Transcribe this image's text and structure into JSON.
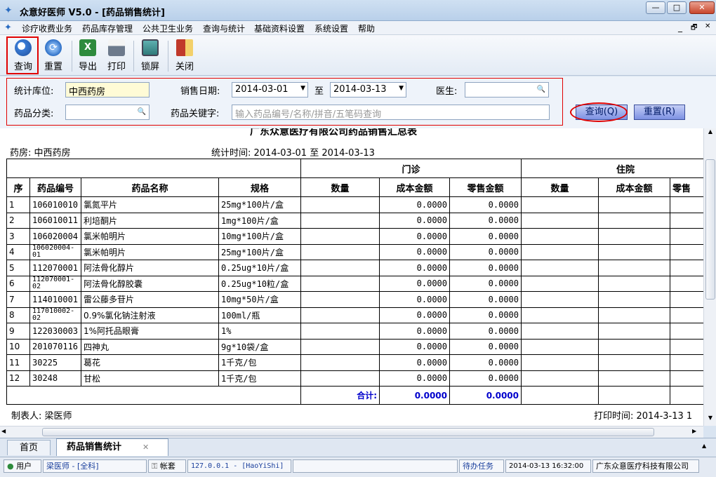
{
  "window": {
    "title": "众意好医师 V5.0 - [药品销售统计]",
    "minimize": "—",
    "maximize": "□",
    "close": "✕"
  },
  "menu": [
    "诊疗收费业务",
    "药品库存管理",
    "公共卫生业务",
    "查询与统计",
    "基础资料设置",
    "系统设置",
    "帮助"
  ],
  "mdi_controls": [
    "_",
    "🗗",
    "✕"
  ],
  "toolbar": [
    {
      "label": "查询",
      "icon": "magnifier-icon",
      "color": "#3a7bd5"
    },
    {
      "label": "重置",
      "icon": "refresh-icon",
      "color": "#2d6fc6"
    },
    {
      "label": "导出",
      "icon": "excel-export-icon",
      "color": "#2e8b3d"
    },
    {
      "label": "打印",
      "icon": "printer-icon",
      "color": "#6d7a8c"
    },
    {
      "label": "锁屏",
      "icon": "monitor-lock-icon",
      "color": "#3a8a8a"
    },
    {
      "label": "关闭",
      "icon": "exit-door-icon",
      "color": "#c0392b"
    }
  ],
  "filters": {
    "warehouse_label": "统计库位:",
    "warehouse_value": "中西药房",
    "date_label": "销售日期:",
    "date_from": "2014-03-01",
    "date_to_label": "至",
    "date_to": "2014-03-13",
    "doctor_label": "医生:",
    "doctor_value": "",
    "category_label": "药品分类:",
    "category_value": "",
    "keyword_label": "药品关键字:",
    "keyword_placeholder": "输入药品编号/名称/拼音/五笔码查询",
    "query_btn": "查询(Q)",
    "reset_btn": "重置(R)"
  },
  "report": {
    "title": "广东众意医疗有限公司药品销售汇总表",
    "pharmacy": "药房: 中西药房",
    "period": "统计时间: 2014-03-01 至 2014-03-13",
    "group_outpatient": "门诊",
    "group_inpatient": "住院",
    "columns": [
      "序",
      "药品编号",
      "药品名称",
      "规格",
      "数量",
      "成本金额",
      "零售金额",
      "数量",
      "成本金额",
      "零售"
    ],
    "rows": [
      [
        "1",
        "106010010",
        "氯氮平片",
        "25mg*100片/盒",
        "",
        "0.0000",
        "0.0000"
      ],
      [
        "2",
        "106010011",
        "利培酮片",
        "1mg*100片/盒",
        "",
        "0.0000",
        "0.0000"
      ],
      [
        "3",
        "106020004",
        "氯米帕明片",
        "10mg*100片/盒",
        "",
        "0.0000",
        "0.0000"
      ],
      [
        "4",
        "106020004-01",
        "氯米帕明片",
        "25mg*100片/盒",
        "",
        "0.0000",
        "0.0000"
      ],
      [
        "5",
        "112070001",
        "阿法骨化醇片",
        "0.25ug*10片/盒",
        "",
        "0.0000",
        "0.0000"
      ],
      [
        "6",
        "112070001-02",
        "阿法骨化醇胶囊",
        "0.25ug*10粒/盒",
        "",
        "0.0000",
        "0.0000"
      ],
      [
        "7",
        "114010001",
        "雷公藤多苷片",
        "10mg*50片/盒",
        "",
        "0.0000",
        "0.0000"
      ],
      [
        "8",
        "117010002-02",
        "0.9%氯化钠注射液",
        "100ml/瓶",
        "",
        "0.0000",
        "0.0000"
      ],
      [
        "9",
        "122030003",
        "1%阿托品眼膏",
        "1%",
        "",
        "0.0000",
        "0.0000"
      ],
      [
        "10",
        "201070116",
        "四神丸",
        "9g*10袋/盒",
        "",
        "0.0000",
        "0.0000"
      ],
      [
        "11",
        "30225",
        "葛花",
        "1千克/包",
        "",
        "0.0000",
        "0.0000"
      ],
      [
        "12",
        "30248",
        "甘松",
        "1千克/包",
        "",
        "0.0000",
        "0.0000"
      ]
    ],
    "total_label": "合计:",
    "total_cost": "0.0000",
    "total_retail": "0.0000",
    "maker": "制表人: 梁医师",
    "print_time": "打印时间: 2014-3-13 1"
  },
  "tabs": [
    {
      "label": "首页"
    },
    {
      "label": "药品销售统计",
      "close": "✕"
    }
  ],
  "status": {
    "user_label": "用户",
    "user_value": "梁医师 - [全科]",
    "account_label": "帐套",
    "account_value": "127.0.0.1 - [HaoYiShi]",
    "pending": "待办任务",
    "datetime": "2014-03-13 16:32:00",
    "company": "广东众意医疗科技有限公司"
  }
}
